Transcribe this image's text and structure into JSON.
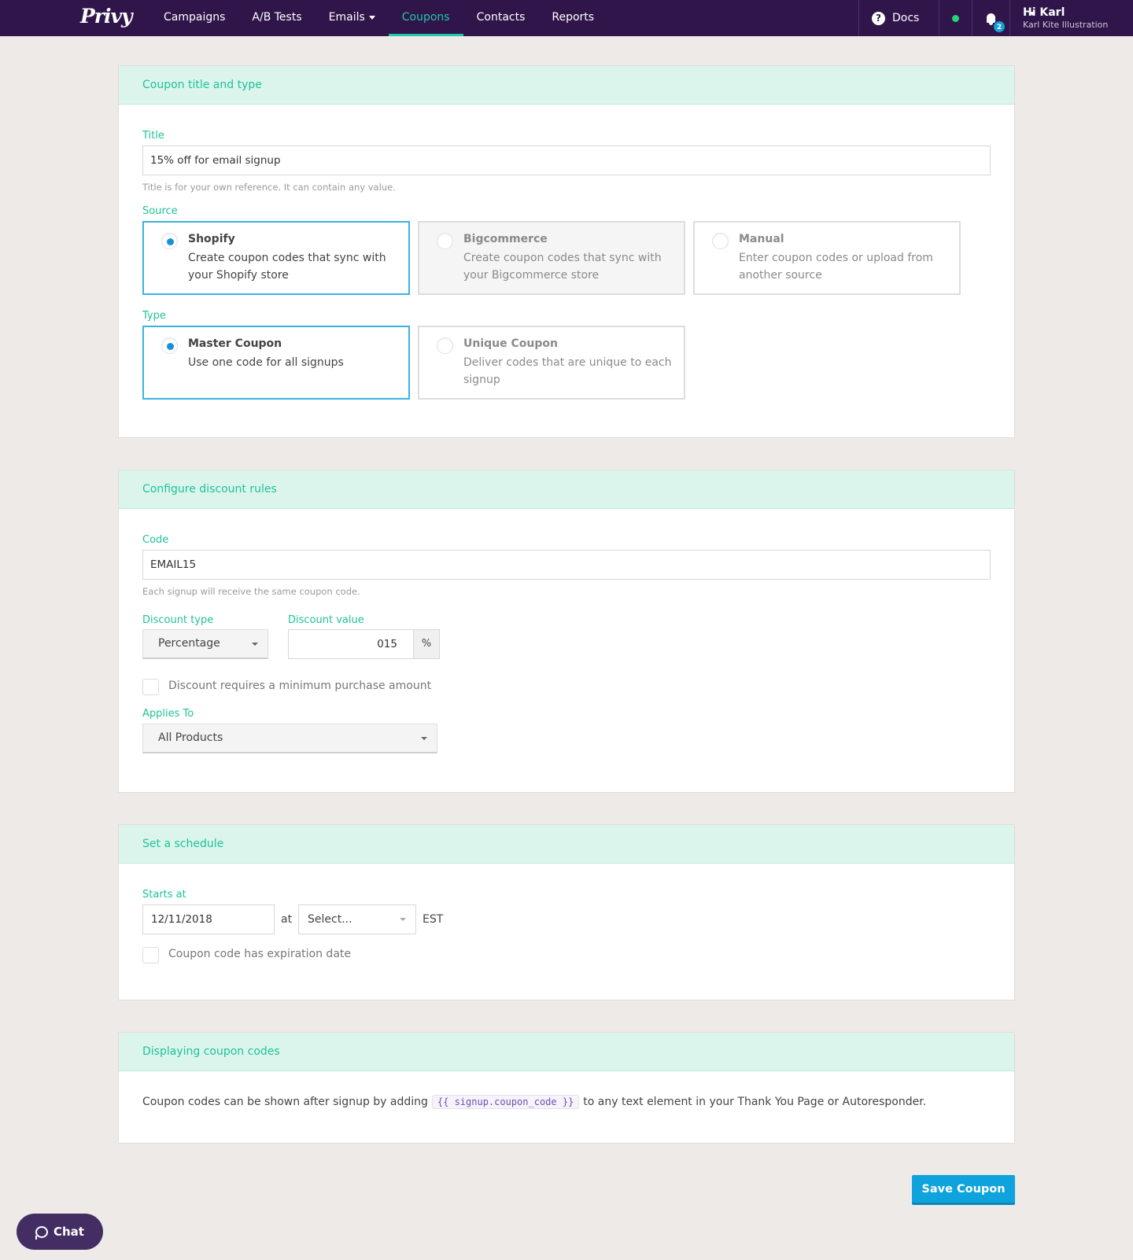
{
  "nav": {
    "logo": "Privy",
    "links": [
      {
        "label": "Campaigns"
      },
      {
        "label": "A/B Tests"
      },
      {
        "label": "Emails"
      },
      {
        "label": "Coupons"
      },
      {
        "label": "Contacts"
      },
      {
        "label": "Reports"
      }
    ],
    "active": "Coupons",
    "docs_label": "Docs",
    "help_icon": "?",
    "notification_count": "2",
    "user_greeting": "Hi Karl",
    "user_org": "Karl Kite Illustration",
    "status_color": "#22d47a"
  },
  "section1": {
    "heading": "Coupon title and type",
    "title_label": "Title",
    "title_value": "15% off for email signup",
    "title_help": "Title is for your own reference. It can contain any value.",
    "source_label": "Source",
    "sources": [
      {
        "title": "Shopify",
        "desc": "Create coupon codes that sync with your Shopify store",
        "selected": true
      },
      {
        "title": "Bigcommerce",
        "desc": "Create coupon codes that sync with your Bigcommerce store",
        "selected": false
      },
      {
        "title": "Manual",
        "desc": "Enter coupon codes or upload from another source",
        "selected": false
      }
    ],
    "type_label": "Type",
    "types": [
      {
        "title": "Master Coupon",
        "desc": "Use one code for all signups",
        "selected": true
      },
      {
        "title": "Unique Coupon",
        "desc": "Deliver codes that are unique to each signup",
        "selected": false
      }
    ]
  },
  "section2": {
    "heading": "Configure discount rules",
    "code_label": "Code",
    "code_value": "EMAIL15",
    "code_help": "Each signup will receive the same coupon code.",
    "discount_type_label": "Discount type",
    "discount_type_value": "Percentage",
    "discount_value_label": "Discount value",
    "discount_value": "015",
    "discount_unit": "%",
    "min_purchase_label": "Discount requires a minimum purchase amount",
    "min_purchase_checked": false,
    "applies_to_label": "Applies To",
    "applies_to_value": "All Products"
  },
  "section3": {
    "heading": "Set a schedule",
    "starts_label": "Starts at",
    "start_date": "12/11/2018",
    "at_label": "at",
    "time_placeholder": "Select...",
    "timezone": "EST",
    "expiration_label": "Coupon code has expiration date",
    "expiration_checked": false
  },
  "section4": {
    "heading": "Displaying coupon codes",
    "text_before": "Coupon codes can be shown after signup by adding",
    "code_snippet": "{{ signup.coupon_code }}",
    "text_after": "to any text element in your Thank You Page or Autoresponder."
  },
  "actions": {
    "save_label": "Save Coupon",
    "chat_label": "Chat"
  },
  "colors": {
    "nav_bg": "#2f1549",
    "accent_green": "#1ec29a",
    "primary_blue": "#0ea3dc",
    "selected_border": "#3cb2e3"
  }
}
